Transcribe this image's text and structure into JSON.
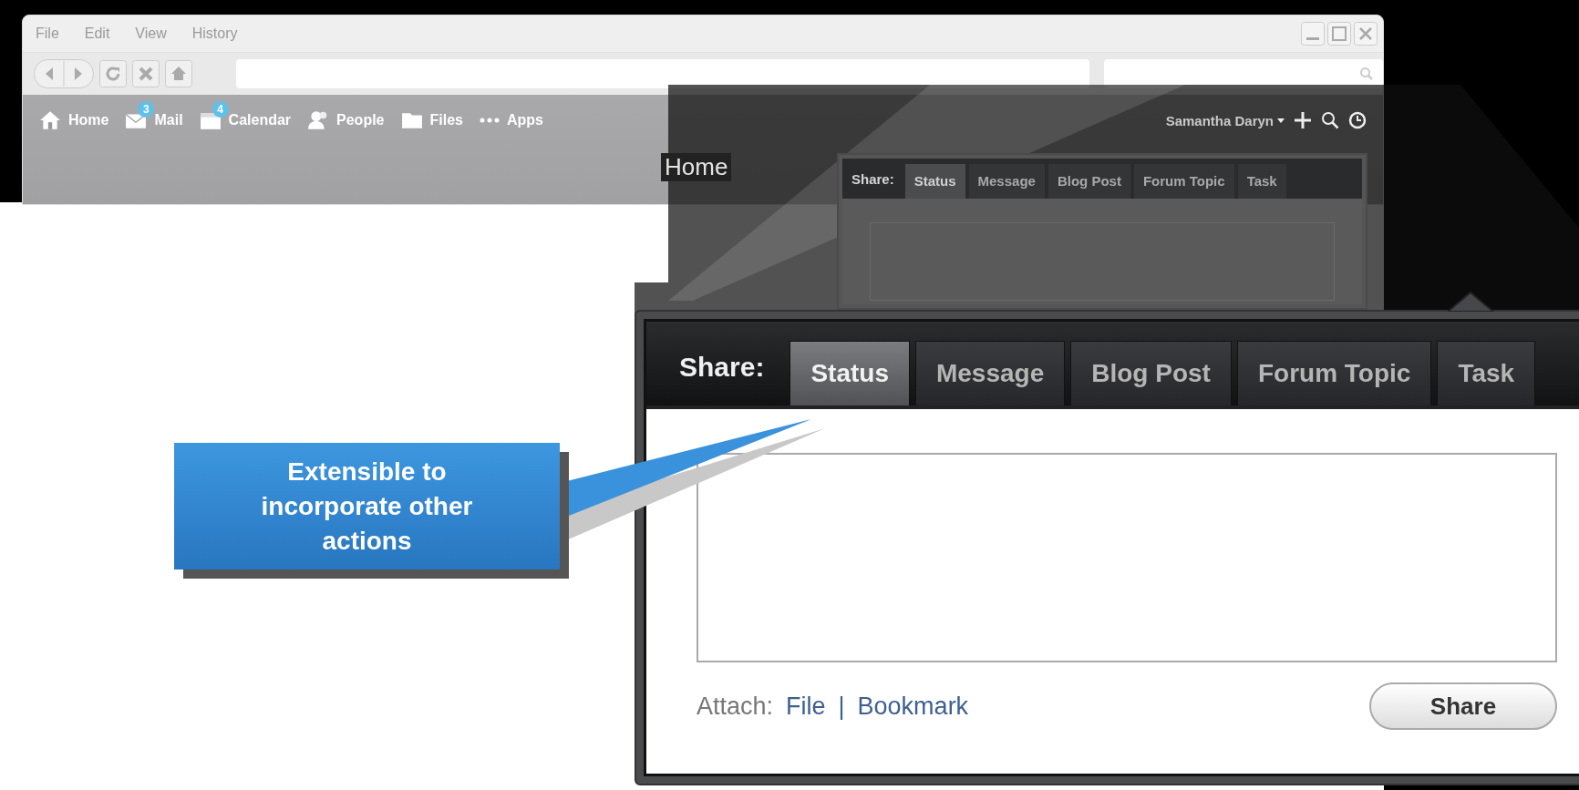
{
  "browser": {
    "menu": [
      "File",
      "Edit",
      "View",
      "History"
    ]
  },
  "nav": {
    "items": [
      {
        "kind": "home",
        "label": "Home"
      },
      {
        "kind": "mail",
        "label": "Mail",
        "badge": "3"
      },
      {
        "kind": "calendar",
        "label": "Calendar",
        "badge": "4"
      },
      {
        "kind": "people",
        "label": "People"
      },
      {
        "kind": "files",
        "label": "Files"
      },
      {
        "kind": "apps",
        "label": "Apps"
      }
    ],
    "user": "Samantha Daryn",
    "page_title": "Home"
  },
  "mini_share": {
    "label": "Share:",
    "tabs": [
      {
        "label": "Status",
        "selected": true
      },
      {
        "label": "Message",
        "selected": false
      },
      {
        "label": "Blog Post",
        "selected": false
      },
      {
        "label": "Forum Topic",
        "selected": false
      },
      {
        "label": "Task",
        "selected": false
      }
    ]
  },
  "share_panel": {
    "label": "Share:",
    "tabs": [
      {
        "label": "Status",
        "selected": true
      },
      {
        "label": "Message",
        "selected": false
      },
      {
        "label": "Blog Post",
        "selected": false
      },
      {
        "label": "Forum Topic",
        "selected": false
      },
      {
        "label": "Task",
        "selected": false
      }
    ],
    "attach_label": "Attach:",
    "attach_links": [
      "File",
      "Bookmark"
    ],
    "separator": "|",
    "button": "Share"
  },
  "callout": "Extensible to incorporate other actions"
}
